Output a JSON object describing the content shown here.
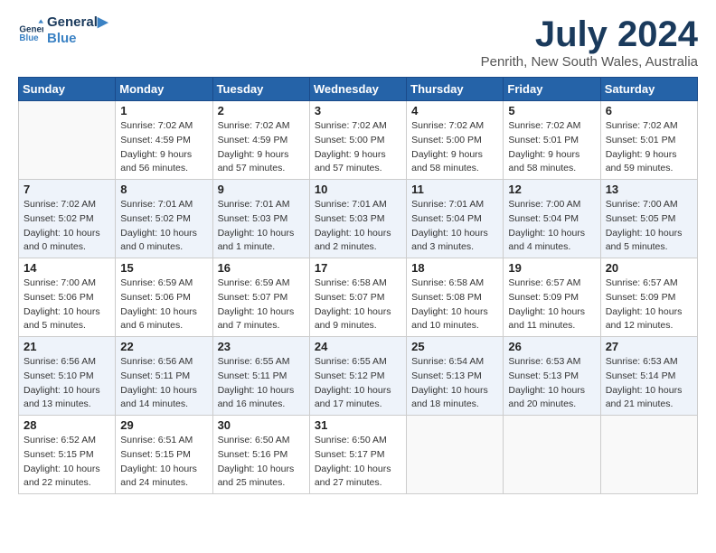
{
  "header": {
    "logo_line1": "General",
    "logo_line2": "Blue",
    "month_year": "July 2024",
    "location": "Penrith, New South Wales, Australia"
  },
  "days_of_week": [
    "Sunday",
    "Monday",
    "Tuesday",
    "Wednesday",
    "Thursday",
    "Friday",
    "Saturday"
  ],
  "weeks": [
    [
      {
        "day": "",
        "info": ""
      },
      {
        "day": "1",
        "info": "Sunrise: 7:02 AM\nSunset: 4:59 PM\nDaylight: 9 hours\nand 56 minutes."
      },
      {
        "day": "2",
        "info": "Sunrise: 7:02 AM\nSunset: 4:59 PM\nDaylight: 9 hours\nand 57 minutes."
      },
      {
        "day": "3",
        "info": "Sunrise: 7:02 AM\nSunset: 5:00 PM\nDaylight: 9 hours\nand 57 minutes."
      },
      {
        "day": "4",
        "info": "Sunrise: 7:02 AM\nSunset: 5:00 PM\nDaylight: 9 hours\nand 58 minutes."
      },
      {
        "day": "5",
        "info": "Sunrise: 7:02 AM\nSunset: 5:01 PM\nDaylight: 9 hours\nand 58 minutes."
      },
      {
        "day": "6",
        "info": "Sunrise: 7:02 AM\nSunset: 5:01 PM\nDaylight: 9 hours\nand 59 minutes."
      }
    ],
    [
      {
        "day": "7",
        "info": "Sunrise: 7:02 AM\nSunset: 5:02 PM\nDaylight: 10 hours\nand 0 minutes."
      },
      {
        "day": "8",
        "info": "Sunrise: 7:01 AM\nSunset: 5:02 PM\nDaylight: 10 hours\nand 0 minutes."
      },
      {
        "day": "9",
        "info": "Sunrise: 7:01 AM\nSunset: 5:03 PM\nDaylight: 10 hours\nand 1 minute."
      },
      {
        "day": "10",
        "info": "Sunrise: 7:01 AM\nSunset: 5:03 PM\nDaylight: 10 hours\nand 2 minutes."
      },
      {
        "day": "11",
        "info": "Sunrise: 7:01 AM\nSunset: 5:04 PM\nDaylight: 10 hours\nand 3 minutes."
      },
      {
        "day": "12",
        "info": "Sunrise: 7:00 AM\nSunset: 5:04 PM\nDaylight: 10 hours\nand 4 minutes."
      },
      {
        "day": "13",
        "info": "Sunrise: 7:00 AM\nSunset: 5:05 PM\nDaylight: 10 hours\nand 5 minutes."
      }
    ],
    [
      {
        "day": "14",
        "info": "Sunrise: 7:00 AM\nSunset: 5:06 PM\nDaylight: 10 hours\nand 5 minutes."
      },
      {
        "day": "15",
        "info": "Sunrise: 6:59 AM\nSunset: 5:06 PM\nDaylight: 10 hours\nand 6 minutes."
      },
      {
        "day": "16",
        "info": "Sunrise: 6:59 AM\nSunset: 5:07 PM\nDaylight: 10 hours\nand 7 minutes."
      },
      {
        "day": "17",
        "info": "Sunrise: 6:58 AM\nSunset: 5:07 PM\nDaylight: 10 hours\nand 9 minutes."
      },
      {
        "day": "18",
        "info": "Sunrise: 6:58 AM\nSunset: 5:08 PM\nDaylight: 10 hours\nand 10 minutes."
      },
      {
        "day": "19",
        "info": "Sunrise: 6:57 AM\nSunset: 5:09 PM\nDaylight: 10 hours\nand 11 minutes."
      },
      {
        "day": "20",
        "info": "Sunrise: 6:57 AM\nSunset: 5:09 PM\nDaylight: 10 hours\nand 12 minutes."
      }
    ],
    [
      {
        "day": "21",
        "info": "Sunrise: 6:56 AM\nSunset: 5:10 PM\nDaylight: 10 hours\nand 13 minutes."
      },
      {
        "day": "22",
        "info": "Sunrise: 6:56 AM\nSunset: 5:11 PM\nDaylight: 10 hours\nand 14 minutes."
      },
      {
        "day": "23",
        "info": "Sunrise: 6:55 AM\nSunset: 5:11 PM\nDaylight: 10 hours\nand 16 minutes."
      },
      {
        "day": "24",
        "info": "Sunrise: 6:55 AM\nSunset: 5:12 PM\nDaylight: 10 hours\nand 17 minutes."
      },
      {
        "day": "25",
        "info": "Sunrise: 6:54 AM\nSunset: 5:13 PM\nDaylight: 10 hours\nand 18 minutes."
      },
      {
        "day": "26",
        "info": "Sunrise: 6:53 AM\nSunset: 5:13 PM\nDaylight: 10 hours\nand 20 minutes."
      },
      {
        "day": "27",
        "info": "Sunrise: 6:53 AM\nSunset: 5:14 PM\nDaylight: 10 hours\nand 21 minutes."
      }
    ],
    [
      {
        "day": "28",
        "info": "Sunrise: 6:52 AM\nSunset: 5:15 PM\nDaylight: 10 hours\nand 22 minutes."
      },
      {
        "day": "29",
        "info": "Sunrise: 6:51 AM\nSunset: 5:15 PM\nDaylight: 10 hours\nand 24 minutes."
      },
      {
        "day": "30",
        "info": "Sunrise: 6:50 AM\nSunset: 5:16 PM\nDaylight: 10 hours\nand 25 minutes."
      },
      {
        "day": "31",
        "info": "Sunrise: 6:50 AM\nSunset: 5:17 PM\nDaylight: 10 hours\nand 27 minutes."
      },
      {
        "day": "",
        "info": ""
      },
      {
        "day": "",
        "info": ""
      },
      {
        "day": "",
        "info": ""
      }
    ]
  ]
}
